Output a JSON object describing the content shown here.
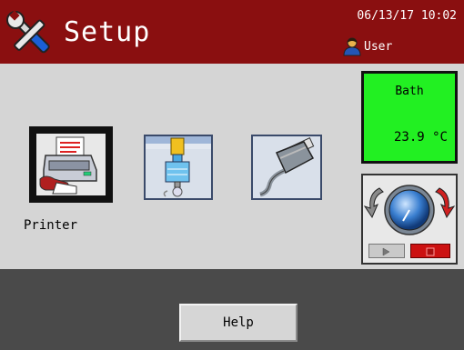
{
  "header": {
    "title": "Setup",
    "datetime": "06/13/17 10:02",
    "user": "User",
    "background_color": "#8a0f10"
  },
  "tiles": [
    {
      "id": "printer",
      "icon": "printer-icon",
      "label": "Printer"
    },
    {
      "id": "valve",
      "icon": "valve-flow-icon",
      "label": ""
    },
    {
      "id": "usb",
      "icon": "usb-cable-icon",
      "label": ""
    }
  ],
  "bath": {
    "title": "Bath",
    "temperature": "23.9 °C",
    "background_color": "#22f022"
  },
  "pump": {
    "icon": "pump-rotation-icon",
    "play_icon": "play-icon",
    "stop_icon": "stop-icon"
  },
  "footer": {
    "help_label": "Help"
  }
}
